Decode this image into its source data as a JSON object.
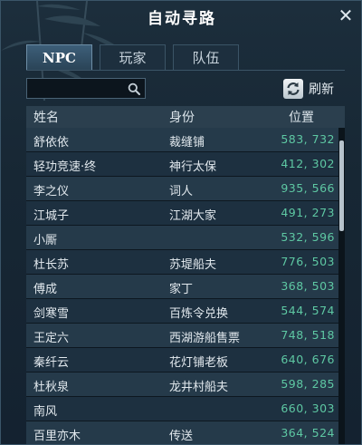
{
  "window": {
    "title": "自动寻路",
    "close_symbol": "✕"
  },
  "tabs": [
    {
      "label": "NPC",
      "active": true
    },
    {
      "label": "玩家",
      "active": false
    },
    {
      "label": "队伍",
      "active": false
    }
  ],
  "search": {
    "value": "",
    "placeholder": ""
  },
  "refresh": {
    "label": "刷新"
  },
  "table": {
    "headers": {
      "name": "姓名",
      "title": "身份",
      "position": "位置"
    },
    "rows": [
      {
        "name": "舒依依",
        "title": "裁缝铺",
        "position": "583, 732"
      },
      {
        "name": "轻功竞速·终",
        "title": "神行太保",
        "position": "412, 302"
      },
      {
        "name": "李之仪",
        "title": "词人",
        "position": "935, 566"
      },
      {
        "name": "江城子",
        "title": "江湖大家",
        "position": "491, 273"
      },
      {
        "name": "小厮",
        "title": "",
        "position": "532, 596"
      },
      {
        "name": "杜长苏",
        "title": "苏堤船夫",
        "position": "776, 503"
      },
      {
        "name": "傅成",
        "title": "家丁",
        "position": "368, 503"
      },
      {
        "name": "剑寒雪",
        "title": "百炼令兑换",
        "position": "544, 574"
      },
      {
        "name": "王定六",
        "title": "西湖游船售票",
        "position": "748, 518"
      },
      {
        "name": "秦纤云",
        "title": "花灯铺老板",
        "position": "640, 676"
      },
      {
        "name": "杜秋泉",
        "title": "龙井村船夫",
        "position": "598, 285"
      },
      {
        "name": "南风",
        "title": "",
        "position": "660, 303"
      },
      {
        "name": "百里亦木",
        "title": "传送",
        "position": "364, 524"
      }
    ]
  },
  "colors": {
    "background": "#172734",
    "position_text": "#5ec8a3",
    "active_tab": "#3d5f79",
    "row_odd": "#253a4a",
    "row_even": "#1d3040"
  },
  "icons": {
    "search": "search-icon",
    "refresh": "refresh-icon",
    "close": "close-icon"
  }
}
